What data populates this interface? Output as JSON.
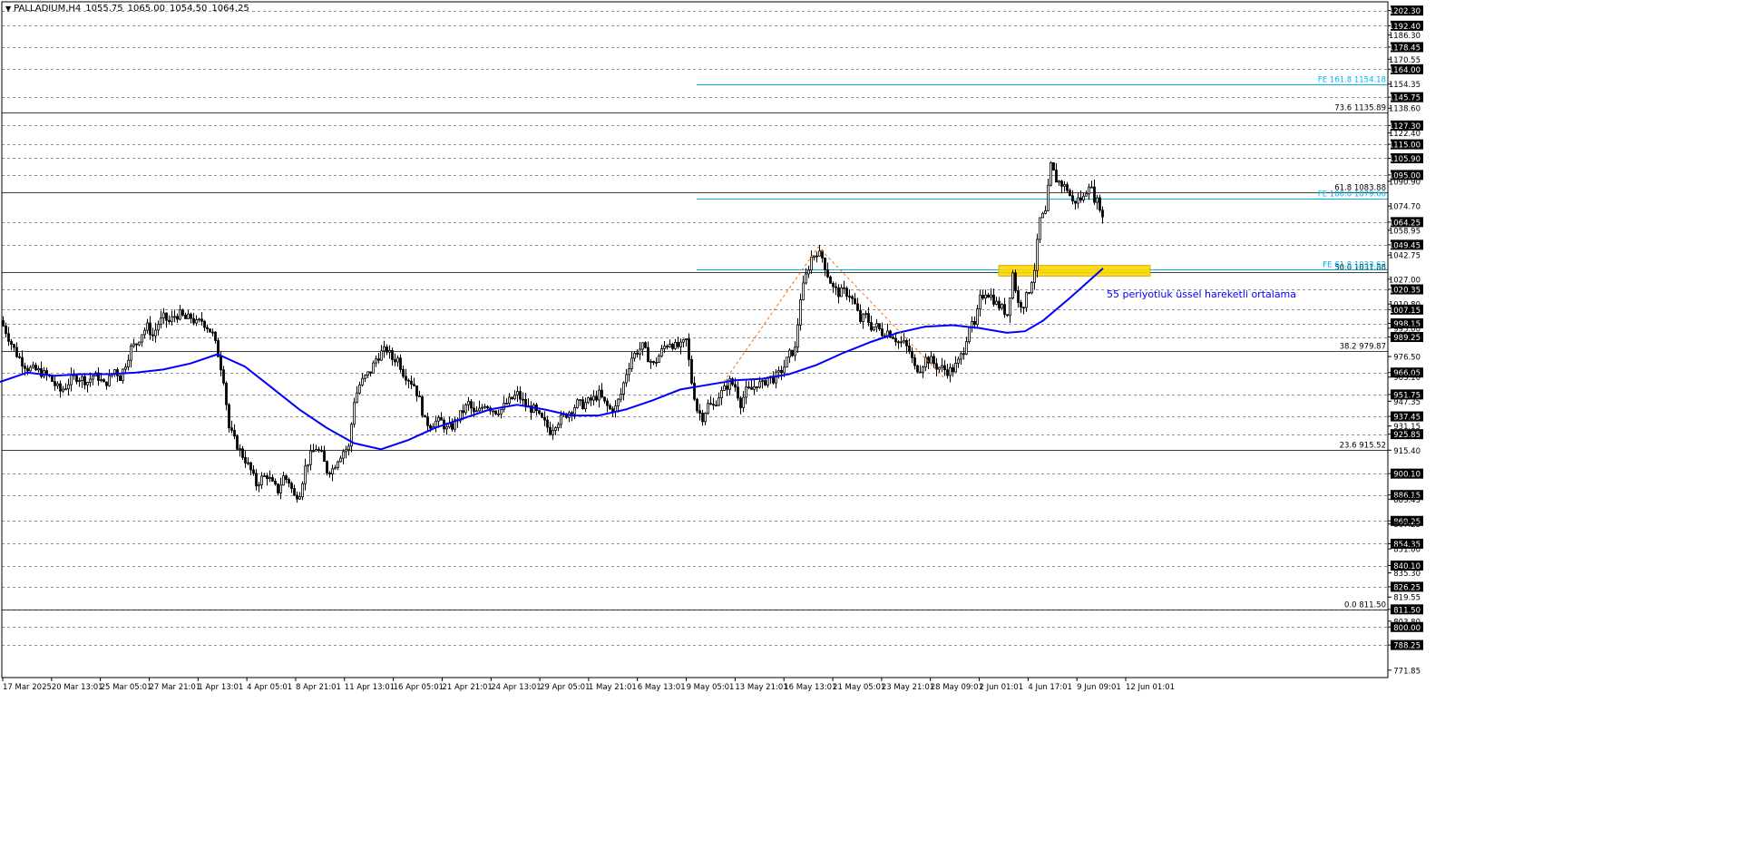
{
  "header": {
    "symbol": "PALLADIUM,H4",
    "open": "1055.75",
    "high": "1065.00",
    "low": "1054.50",
    "close": "1064.25"
  },
  "colors": {
    "background": "#ffffff",
    "axis": "#000000",
    "grid_dashed": "#000000",
    "candle": "#000000",
    "ema": "#0000ff",
    "fib_extension": "#00b4e6",
    "fib_retracement": "#000000",
    "zigzag": "#ff6a00",
    "zone_fill": "#ffd700"
  },
  "chart_data": {
    "type": "candlestick",
    "instrument": "PALLADIUM",
    "timeframe": "H4",
    "ylim": [
      767,
      1208
    ],
    "price_labels": [
      "1202.30",
      "1192.40",
      "1186.30",
      "1178.45",
      "1170.55",
      "1164.00",
      "1154.35",
      "1145.75",
      "1138.60",
      "1127.30",
      "1122.40",
      "1115.00",
      "1105.90",
      "1095.00",
      "1090.90",
      "1074.70",
      "1064.25",
      "1058.95",
      "1049.45",
      "1042.75",
      "1027.00",
      "1020.35",
      "1010.80",
      "1007.15",
      "998.15",
      "995.00",
      "989.25",
      "976.50",
      "966.05",
      "963.10",
      "951.75",
      "947.35",
      "937.45",
      "931.15",
      "925.85",
      "915.40",
      "900.10",
      "886.15",
      "883.45",
      "869.25",
      "867.25",
      "854.35",
      "851.00",
      "840.10",
      "835.30",
      "826.25",
      "819.55",
      "811.50",
      "803.80",
      "800.00",
      "788.25",
      "771.85"
    ],
    "highlighted_prices": [
      "1202.30",
      "1192.40",
      "1178.45",
      "1164.00",
      "1145.75",
      "1127.30",
      "1115.00",
      "1105.90",
      "1095.00",
      "1064.25",
      "1049.45",
      "1020.35",
      "1007.15",
      "998.15",
      "989.25",
      "966.05",
      "951.75",
      "937.45",
      "925.85",
      "900.10",
      "886.15",
      "869.25",
      "854.35",
      "840.10",
      "826.25",
      "811.50",
      "800.00",
      "788.25"
    ],
    "plain_prices": [
      "1186.30",
      "1170.55",
      "1154.35",
      "1138.60",
      "1122.40",
      "1090.90",
      "1074.70",
      "1058.95",
      "1042.75",
      "1027.00",
      "1010.80",
      "995.00",
      "976.50",
      "963.10",
      "947.35",
      "931.15",
      "915.40",
      "883.45",
      "867.25",
      "851.00",
      "835.30",
      "819.55",
      "803.80",
      "771.85"
    ],
    "x_tick_labels": [
      "17 Mar 2025",
      "20 Mar 13:01",
      "25 Mar 05:01",
      "27 Mar 21:01",
      "1 Apr 13:01",
      "4 Apr 05:01",
      "8 Apr 21:01",
      "11 Apr 13:01",
      "16 Apr 05:01",
      "21 Apr 21:01",
      "24 Apr 13:01",
      "29 Apr 05:01",
      "1 May 21:01",
      "6 May 13:01",
      "9 May 05:01",
      "13 May 21:01",
      "16 May 13:01",
      "21 May 05:01",
      "23 May 21:01",
      "28 May 09:01",
      "2 Jun 01:01",
      "4 Jun 17:01",
      "9 Jun 09:01",
      "12 Jun 01:01"
    ],
    "close_anchors": [
      [
        0,
        1000
      ],
      [
        6,
        993
      ],
      [
        12,
        985
      ],
      [
        18,
        978
      ],
      [
        24,
        973
      ],
      [
        30,
        969
      ],
      [
        36,
        968
      ],
      [
        42,
        967
      ],
      [
        48,
        965
      ],
      [
        54,
        963
      ],
      [
        60,
        958
      ],
      [
        66,
        954
      ],
      [
        72,
        957
      ],
      [
        78,
        962
      ],
      [
        84,
        963
      ],
      [
        90,
        962
      ],
      [
        96,
        960
      ],
      [
        102,
        964
      ],
      [
        108,
        963
      ],
      [
        114,
        958
      ],
      [
        120,
        962
      ],
      [
        126,
        968
      ],
      [
        132,
        963
      ],
      [
        138,
        972
      ],
      [
        144,
        982
      ],
      [
        150,
        985
      ],
      [
        156,
        992
      ],
      [
        162,
        996
      ],
      [
        168,
        990
      ],
      [
        174,
        998
      ],
      [
        180,
        1002
      ],
      [
        186,
        999
      ],
      [
        192,
        1003
      ],
      [
        198,
        1004
      ],
      [
        204,
        1001
      ],
      [
        210,
        1002
      ],
      [
        216,
        998
      ],
      [
        222,
        1000
      ],
      [
        228,
        996
      ],
      [
        234,
        991
      ],
      [
        240,
        978
      ],
      [
        246,
        962
      ],
      [
        252,
        930
      ],
      [
        258,
        922
      ],
      [
        264,
        915
      ],
      [
        270,
        909
      ],
      [
        276,
        902
      ],
      [
        282,
        893
      ],
      [
        288,
        897
      ],
      [
        294,
        899
      ],
      [
        300,
        893
      ],
      [
        306,
        889
      ],
      [
        312,
        898
      ],
      [
        318,
        895
      ],
      [
        324,
        885
      ],
      [
        330,
        888
      ],
      [
        336,
        904
      ],
      [
        342,
        912
      ],
      [
        348,
        917
      ],
      [
        354,
        912
      ],
      [
        360,
        902
      ],
      [
        366,
        903
      ],
      [
        372,
        910
      ],
      [
        378,
        915
      ],
      [
        384,
        917
      ],
      [
        390,
        948
      ],
      [
        396,
        958
      ],
      [
        402,
        963
      ],
      [
        408,
        967
      ],
      [
        414,
        975
      ],
      [
        420,
        979
      ],
      [
        426,
        981
      ],
      [
        432,
        975
      ],
      [
        438,
        975
      ],
      [
        444,
        966
      ],
      [
        450,
        962
      ],
      [
        456,
        958
      ],
      [
        462,
        948
      ],
      [
        468,
        934
      ],
      [
        474,
        932
      ],
      [
        480,
        934
      ],
      [
        486,
        934
      ],
      [
        492,
        929
      ],
      [
        498,
        931
      ],
      [
        504,
        936
      ],
      [
        510,
        941
      ],
      [
        516,
        946
      ],
      [
        522,
        939
      ],
      [
        528,
        941
      ],
      [
        534,
        946
      ],
      [
        540,
        943
      ],
      [
        546,
        941
      ],
      [
        552,
        942
      ],
      [
        558,
        946
      ],
      [
        564,
        949
      ],
      [
        570,
        952
      ],
      [
        576,
        947
      ],
      [
        582,
        943
      ],
      [
        588,
        942
      ],
      [
        594,
        937
      ],
      [
        600,
        933
      ],
      [
        606,
        928
      ],
      [
        612,
        933
      ],
      [
        618,
        936
      ],
      [
        624,
        939
      ],
      [
        630,
        942
      ],
      [
        636,
        946
      ],
      [
        642,
        945
      ],
      [
        648,
        947
      ],
      [
        654,
        949
      ],
      [
        660,
        952
      ],
      [
        666,
        946
      ],
      [
        672,
        942
      ],
      [
        678,
        943
      ],
      [
        684,
        952
      ],
      [
        690,
        966
      ],
      [
        696,
        976
      ],
      [
        702,
        980
      ],
      [
        708,
        983
      ],
      [
        714,
        976
      ],
      [
        720,
        971
      ],
      [
        726,
        977
      ],
      [
        732,
        983
      ],
      [
        738,
        986
      ],
      [
        744,
        983
      ],
      [
        750,
        983
      ],
      [
        756,
        987
      ],
      [
        762,
        960
      ],
      [
        768,
        942
      ],
      [
        774,
        937
      ],
      [
        780,
        945
      ],
      [
        786,
        944
      ],
      [
        792,
        951
      ],
      [
        798,
        955
      ],
      [
        804,
        960
      ],
      [
        810,
        957
      ],
      [
        816,
        946
      ],
      [
        822,
        954
      ],
      [
        828,
        955
      ],
      [
        834,
        959
      ],
      [
        840,
        958
      ],
      [
        846,
        963
      ],
      [
        852,
        962
      ],
      [
        858,
        965
      ],
      [
        864,
        970
      ],
      [
        870,
        978
      ],
      [
        876,
        981
      ],
      [
        882,
        1015
      ],
      [
        888,
        1029
      ],
      [
        894,
        1041
      ],
      [
        900,
        1045
      ],
      [
        906,
        1041
      ],
      [
        912,
        1030
      ],
      [
        918,
        1021
      ],
      [
        924,
        1018
      ],
      [
        930,
        1019
      ],
      [
        936,
        1017
      ],
      [
        942,
        1010
      ],
      [
        948,
        1000
      ],
      [
        954,
        1003
      ],
      [
        960,
        996
      ],
      [
        966,
        996
      ],
      [
        972,
        992
      ],
      [
        978,
        993
      ],
      [
        984,
        990
      ],
      [
        990,
        986
      ],
      [
        996,
        985
      ],
      [
        1002,
        980
      ],
      [
        1008,
        969
      ],
      [
        1014,
        969
      ],
      [
        1020,
        975
      ],
      [
        1026,
        974
      ],
      [
        1032,
        970
      ],
      [
        1038,
        969
      ],
      [
        1044,
        967
      ],
      [
        1050,
        968
      ],
      [
        1056,
        973
      ],
      [
        1062,
        981
      ],
      [
        1068,
        997
      ],
      [
        1074,
        996
      ],
      [
        1080,
        1014
      ],
      [
        1086,
        1019
      ],
      [
        1092,
        1016
      ],
      [
        1098,
        1011
      ],
      [
        1104,
        1008
      ],
      [
        1110,
        1004
      ],
      [
        1116,
        1031
      ],
      [
        1122,
        1011
      ],
      [
        1128,
        1011
      ],
      [
        1134,
        1020
      ],
      [
        1140,
        1034
      ],
      [
        1146,
        1066
      ],
      [
        1152,
        1070
      ],
      [
        1158,
        1101
      ],
      [
        1164,
        1092
      ],
      [
        1170,
        1089
      ],
      [
        1176,
        1086
      ],
      [
        1182,
        1077
      ],
      [
        1188,
        1079
      ],
      [
        1194,
        1080
      ],
      [
        1200,
        1090
      ],
      [
        1206,
        1080
      ],
      [
        1212,
        1075
      ],
      [
        1216,
        1064
      ]
    ],
    "ema": {
      "name": "55 periyotluk üssel hareketli ortalama",
      "period": 55,
      "points": [
        [
          0,
          960
        ],
        [
          30,
          966
        ],
        [
          60,
          964
        ],
        [
          90,
          965
        ],
        [
          120,
          965
        ],
        [
          150,
          966
        ],
        [
          180,
          968
        ],
        [
          210,
          972
        ],
        [
          240,
          978
        ],
        [
          270,
          970
        ],
        [
          300,
          956
        ],
        [
          330,
          942
        ],
        [
          360,
          930
        ],
        [
          390,
          920
        ],
        [
          420,
          916
        ],
        [
          450,
          922
        ],
        [
          480,
          930
        ],
        [
          510,
          936
        ],
        [
          540,
          942
        ],
        [
          570,
          945
        ],
        [
          600,
          942
        ],
        [
          630,
          938
        ],
        [
          660,
          938
        ],
        [
          690,
          942
        ],
        [
          720,
          948
        ],
        [
          750,
          955
        ],
        [
          780,
          958
        ],
        [
          810,
          961
        ],
        [
          840,
          962
        ],
        [
          870,
          965
        ],
        [
          900,
          971
        ],
        [
          930,
          979
        ],
        [
          960,
          986
        ],
        [
          990,
          992
        ],
        [
          1020,
          996
        ],
        [
          1050,
          997
        ],
        [
          1080,
          995
        ],
        [
          1110,
          992
        ],
        [
          1130,
          993
        ],
        [
          1150,
          1000
        ],
        [
          1180,
          1015
        ],
        [
          1216,
          1034
        ]
      ]
    },
    "fibonacci_retracement": [
      {
        "label": "73.6 1135.89",
        "price": 1135.89
      },
      {
        "label": "61.8 1083.88",
        "price": 1083.88
      },
      {
        "label": "50.0 1031.88",
        "price": 1031.88
      },
      {
        "label": "38.2 979.87",
        "price": 979.87
      },
      {
        "label": "23.6 915.52",
        "price": 915.52
      },
      {
        "label": "0.0 811.50",
        "price": 811.5
      }
    ],
    "fibonacci_extension": [
      {
        "label": "FE 161.8 1154.18",
        "price": 1154.18
      },
      {
        "label": "FE 100.0 1079.66",
        "price": 1079.66
      },
      {
        "label": "FE 61.8 1033.62",
        "price": 1033.62
      }
    ],
    "zigzag": [
      [
        798,
        960
      ],
      [
        902,
        1048
      ],
      [
        1040,
        963
      ]
    ],
    "support_zone": {
      "low": 1029,
      "high": 1036,
      "x_start": 1101,
      "x_end": 1268
    },
    "annotation": "55 periyotluk üssel hareketli ortalama"
  }
}
